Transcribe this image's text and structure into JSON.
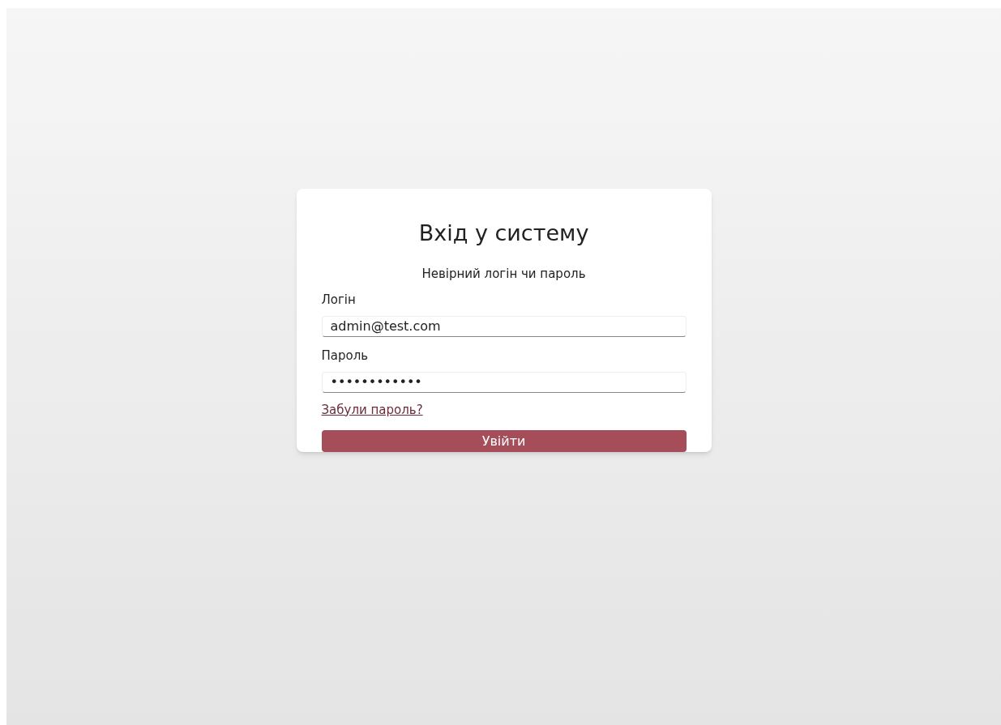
{
  "login_card": {
    "title": "Вхід у систему",
    "error_message": "Невірний логін чи пароль",
    "fields": [
      {
        "label": "Логін",
        "value": "admin@test.com"
      },
      {
        "label": "Пароль",
        "value": "••••••••••••"
      }
    ],
    "forgot_link": "Забули пароль?",
    "submit_button": "Увійти"
  }
}
